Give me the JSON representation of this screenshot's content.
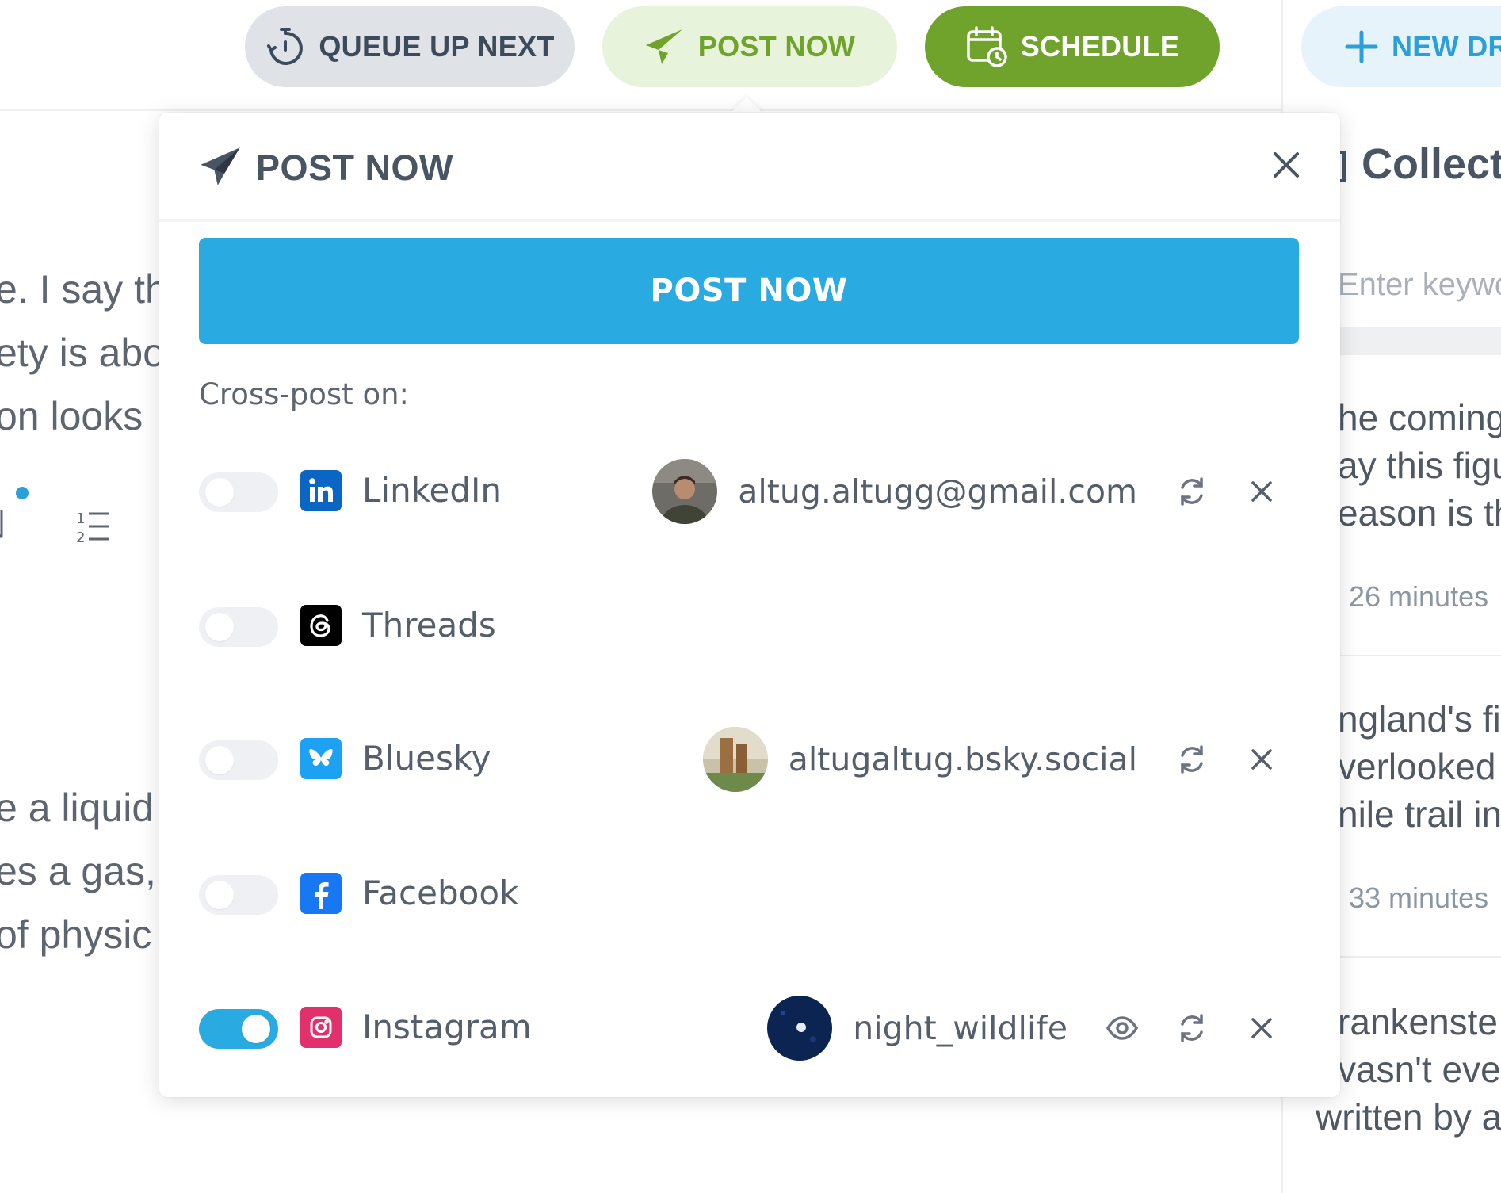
{
  "toolbar": {
    "queue_label": "QUEUE UP NEXT",
    "post_now_label": "POST NOW",
    "schedule_label": "SCHEDULE",
    "new_draft_label": "NEW DR",
    "colors": {
      "green": "#6fa32c",
      "blue": "#2a9fd8"
    }
  },
  "editor_background": {
    "lines": [
      "e. I say th",
      "ety is abo",
      "on looks",
      "e a liquid",
      "es a gas,",
      "of physic"
    ]
  },
  "right_panel": {
    "title": "Collecti",
    "search_placeholder": "Enter keywo",
    "cards": [
      {
        "lines": [
          "he coming",
          "ay this figu",
          "eason is th"
        ],
        "meta": "26 minutes"
      },
      {
        "lines": [
          "ngland's fi",
          "verlooked",
          "nile trail in"
        ],
        "meta": "33 minutes"
      },
      {
        "lines": [
          "rankenste",
          "vasn't ever",
          "written by a"
        ],
        "meta": ""
      }
    ]
  },
  "modal": {
    "title": "POST NOW",
    "post_button_label": "POST NOW",
    "crosspost_label": "Cross-post on:",
    "accent": "#29aae1",
    "networks": [
      {
        "name": "LinkedIn",
        "icon": "linkedin-icon",
        "color": "#0a66c2",
        "enabled": false,
        "account": "altug.altugg@gmail.com"
      },
      {
        "name": "Threads",
        "icon": "threads-icon",
        "color": "#000000",
        "enabled": false,
        "account": ""
      },
      {
        "name": "Bluesky",
        "icon": "bluesky-icon",
        "color": "#1185fe",
        "enabled": false,
        "account": "altugaltug.bsky.social"
      },
      {
        "name": "Facebook",
        "icon": "facebook-icon",
        "color": "#1877f2",
        "enabled": false,
        "account": ""
      },
      {
        "name": "Instagram",
        "icon": "instagram-icon",
        "color": "#e1306c",
        "enabled": true,
        "account": "night_wildlife"
      }
    ]
  }
}
